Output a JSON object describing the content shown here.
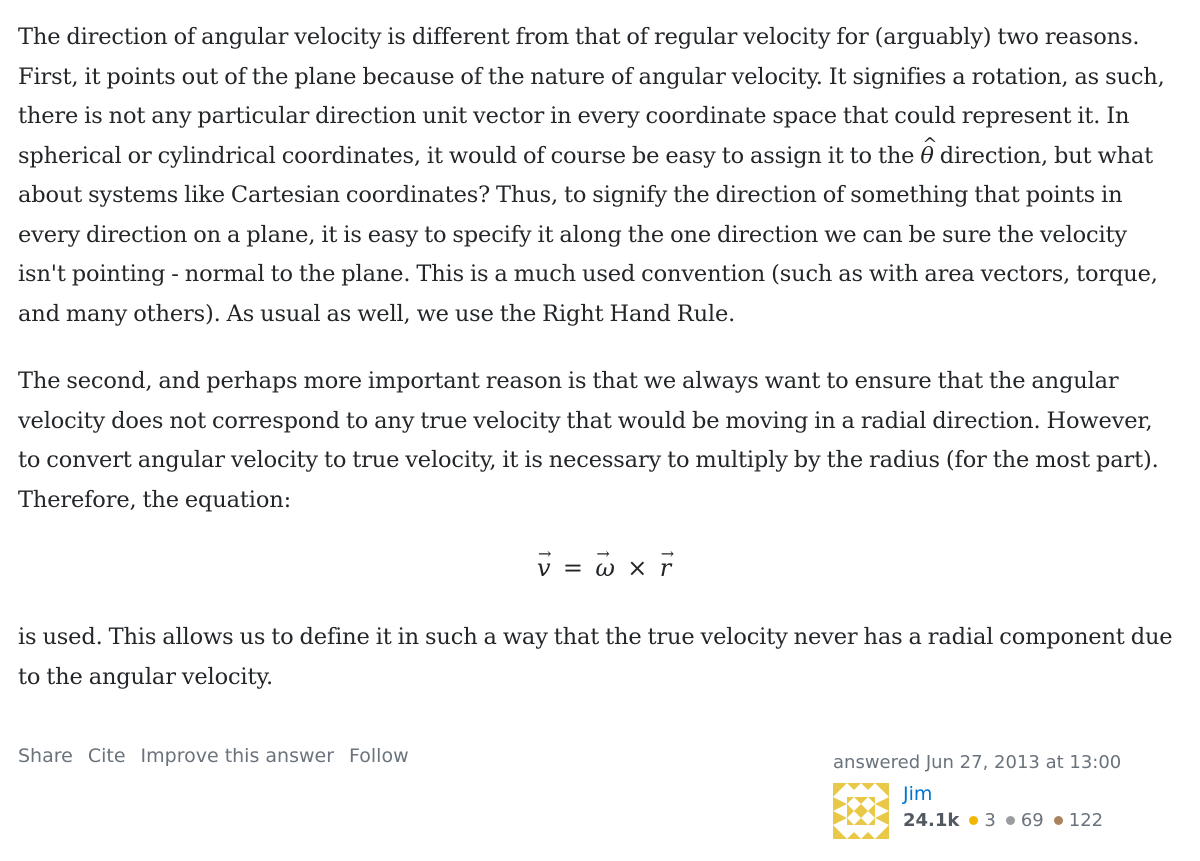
{
  "answer": {
    "p1_before_theta": "The direction of angular velocity is different from that of regular velocity for (arguably) two reasons. First, it points out of the plane because of the nature of angular velocity. It signifies a rotation, as such, there is not any particular direction unit vector in every coordinate space that could represent it. In spherical or cylindrical coordinates, it would of course be easy to assign it to the ",
    "theta_symbol": "θ",
    "theta_hat": "^",
    "p1_after_theta": " direction, but what about systems like Cartesian coordinates? Thus, to signify the direction of something that points in every direction on a plane, it is easy to specify it along the one direction we can be sure the velocity isn't pointing - normal to the plane. This is a much used convention (such as with area vectors, torque, and many others). As usual as well, we use the Right Hand Rule.",
    "p2": "The second, and perhaps more important reason is that we always want to ensure that the angular velocity does not correspond to any true velocity that would be moving in a radial direction. However, to convert angular velocity to true velocity, it is necessary to multiply by the radius (for the most part). Therefore, the equation:",
    "equation": {
      "v": "v",
      "equals": "=",
      "omega": "ω",
      "times": "×",
      "r": "r",
      "arrow": "⃗"
    },
    "p3": "is used. This allows us to define it in such a way that the true velocity never has a radial component due to the angular velocity."
  },
  "post_menu": {
    "share": "Share",
    "cite": "Cite",
    "improve": "Improve this answer",
    "follow": "Follow"
  },
  "user_card": {
    "action": "answered Jun 27, 2013 at 13:00",
    "name": "Jim",
    "reputation": "24.1k",
    "gold": "3",
    "silver": "69",
    "bronze": "122",
    "colors": {
      "gold": "#f1b600",
      "silver": "#9a9c9f",
      "bronze": "#ab825f",
      "avatar_fg": "#e8c846",
      "avatar_bg": "#ffffff"
    }
  }
}
